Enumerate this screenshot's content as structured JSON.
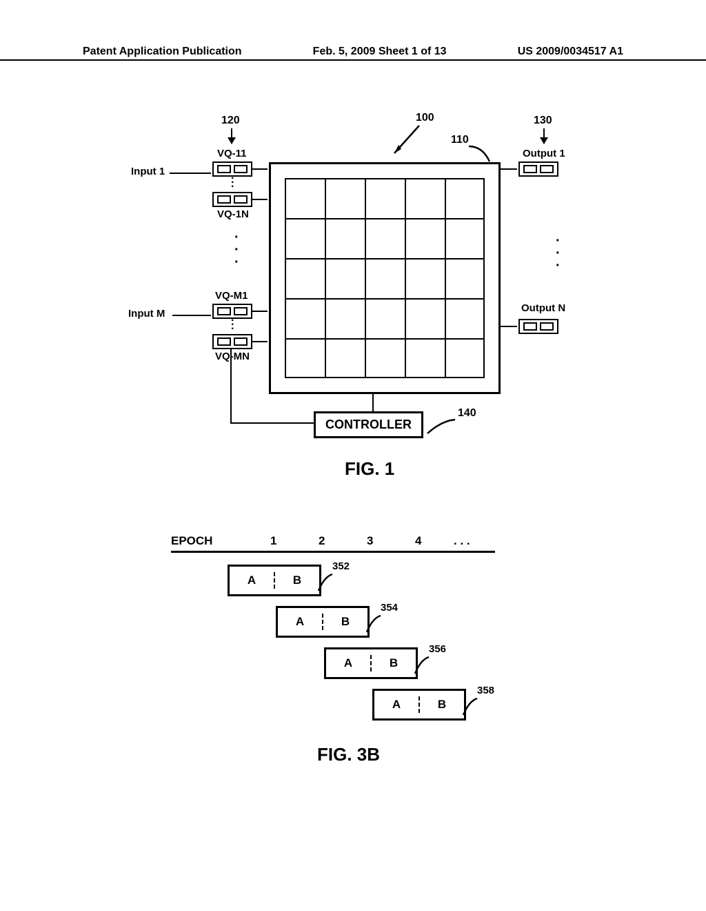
{
  "header": {
    "left": "Patent Application Publication",
    "center": "Feb. 5, 2009  Sheet 1 of 13",
    "right": "US 2009/0034517 A1"
  },
  "fig1": {
    "ref_100": "100",
    "ref_110": "110",
    "ref_120": "120",
    "ref_130": "130",
    "ref_140": "140",
    "input1": "Input 1",
    "inputM": "Input M",
    "output1": "Output 1",
    "outputN": "Output N",
    "vq11": "VQ-11",
    "vq1n": "VQ-1N",
    "vqm1": "VQ-M1",
    "vqmn": "VQ-MN",
    "controller": "CONTROLLER",
    "caption": "FIG. 1"
  },
  "fig3b": {
    "label": "EPOCH",
    "cols": [
      "1",
      "2",
      "3",
      "4",
      ". . ."
    ],
    "a": "A",
    "b": "B",
    "ref_352": "352",
    "ref_354": "354",
    "ref_356": "356",
    "ref_358": "358",
    "caption": "FIG. 3B"
  }
}
